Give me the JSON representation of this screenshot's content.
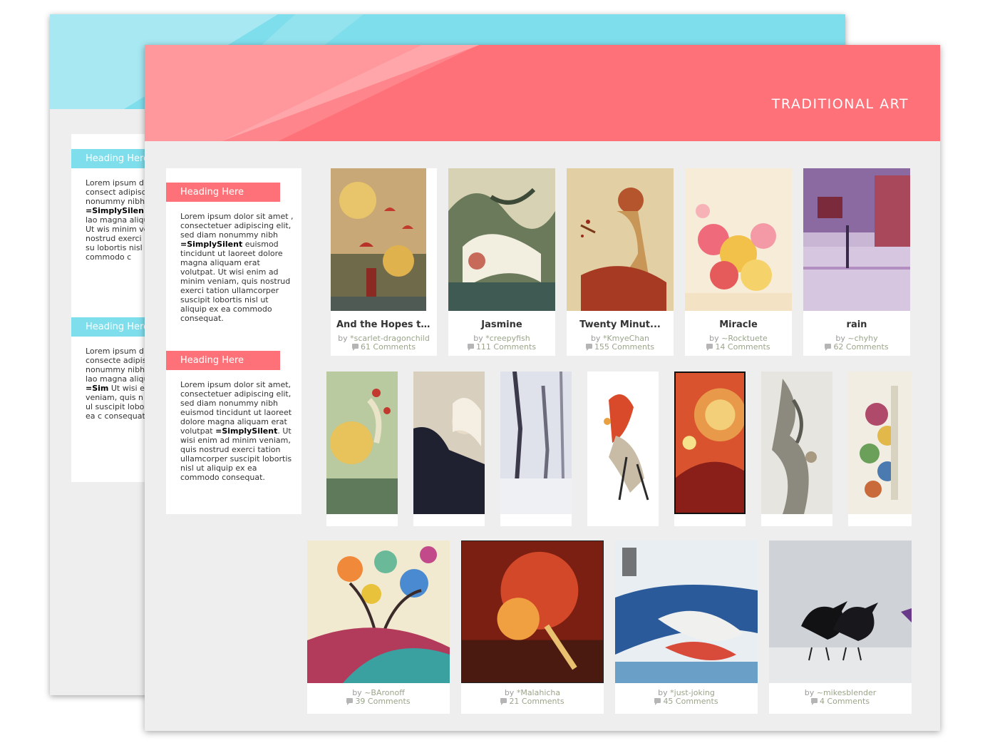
{
  "front": {
    "banner_title": "TRADITIONAL ART",
    "sidebar": {
      "widgets": [
        {
          "heading": "Heading Here",
          "text_before": "Lorem ipsum dolor sit amet , consectetuer adipiscing elit, sed diam nonummy nibh ",
          "bold": "=SimplySilent",
          "text_after": " euismod tincidunt ut laoreet dolore magna aliquam erat volutpat. Ut wisi enim ad minim veniam, quis nostrud exerci tation ullamcorper suscipit lobortis nisl ut aliquip ex ea commodo consequat."
        },
        {
          "heading": "Heading Here",
          "text_before": "Lorem ipsum dolor sit amet, consectetuer adipiscing elit, sed diam nonummy nibh euismod tincidunt ut laoreet dolore magna aliquam erat volutpat ",
          "bold": "=SimplySilent",
          "text_after": ". Ut wisi enim ad minim veniam, quis nostrud exerci tation ullamcorper suscipit lobortis nisl ut aliquip ex ea commodo consequat."
        }
      ]
    },
    "row1": [
      {
        "title": "And the Hopes th...",
        "by": "by",
        "user": "*scarlet-dragonchild",
        "comments": "61 Comments"
      },
      {
        "title": "Jasmine",
        "by": "by",
        "user": "*creepyfish",
        "comments": "111 Comments"
      },
      {
        "title": "Twenty Minut...",
        "by": "by",
        "user": "*KmyeChan",
        "comments": "155 Comments"
      },
      {
        "title": "Miracle",
        "by": "by",
        "user": "~Rocktuete",
        "comments": "14 Comments"
      },
      {
        "title": "rain",
        "by": "by",
        "user": "~chyhy",
        "comments": "62 Comments"
      }
    ],
    "row3": [
      {
        "by": "by",
        "user": "~BAronoff",
        "comments": "39 Comments"
      },
      {
        "by": "by",
        "user": "*Malahicha",
        "comments": "21 Comments"
      },
      {
        "by": "by",
        "user": "*just-joking",
        "comments": "45 Comments"
      },
      {
        "by": "by",
        "user": "~mikesblender",
        "comments": "4 Comments"
      }
    ]
  },
  "back": {
    "sidebar": {
      "widgets": [
        {
          "heading": "Heading Here",
          "text_before": "Lorem ipsum d amet , consect adipiscing elit, nonummy nibh ",
          "bold": "=SimplySilen",
          "text_after": " tincidunt ut lao magna aliquan volutpat. Ut wis minim veniam, nostrud exerci ullamcorper su lobortis nisl ut ea commodo c"
        },
        {
          "heading": "Heading Here",
          "text_before": "Lorem ipsum d amet, consecte adipiscing elit, nonummy nibh tincidunt ut lao magna aliqua volutpat ",
          "bold": "=Sim",
          "text_after": " Ut wisi enim ac veniam, quis n exerci tation ul suscipit lobortis aliquip ex ea c consequat."
        }
      ]
    }
  },
  "colors": {
    "coral": "#fe7178",
    "cyan": "#7fdeec",
    "panel_bg": "#eeeeee"
  },
  "icons": {
    "comment": "comment-bubble-icon"
  }
}
